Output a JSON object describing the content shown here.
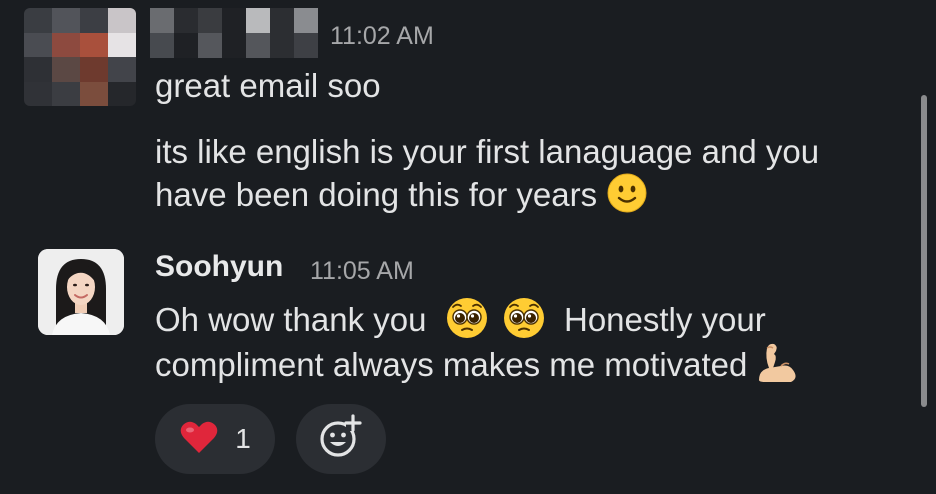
{
  "message1": {
    "timestamp": "11:02 AM",
    "line1": "great email soo",
    "line2": "its like english is your first lanaguage and you",
    "line3": "have been doing this for years"
  },
  "message2": {
    "sender": "Soohyun",
    "timestamp": "11:05 AM",
    "line1_part1": "Oh wow thank you",
    "line1_part2": "Honestly your",
    "line2": "compliment always makes me motivated"
  },
  "reactions": {
    "heart_count": "1"
  },
  "icons": {
    "smile": "slightly-smiling-face-icon",
    "pleading": "pleading-face-icon",
    "flex": "flexed-biceps-icon",
    "heart": "red-heart-icon",
    "add_reaction": "add-reaction-icon"
  },
  "colors": {
    "background": "#1a1d21",
    "text": "#e3e4e5",
    "muted": "#a6a7a9",
    "pill": "#2b2e33",
    "heart": "#e0263b"
  }
}
